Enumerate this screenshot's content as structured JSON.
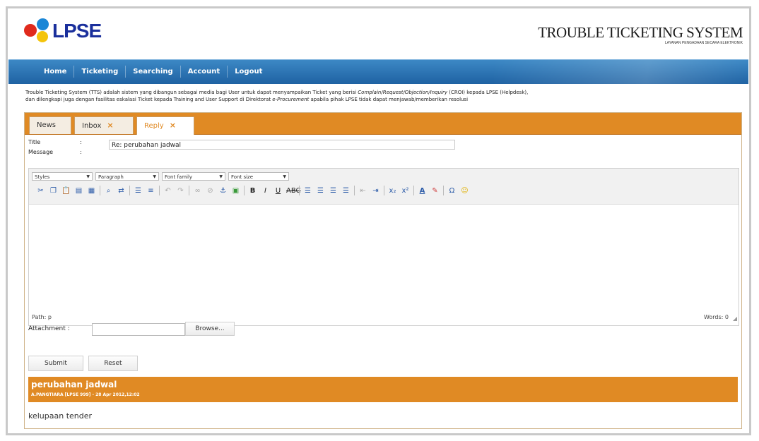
{
  "brand": {
    "logo_text": "LPSE",
    "system_title": "TROUBLE TICKETING SYSTEM",
    "system_subtitle": "LAYANAN PENGADAAN SECARA ELEKTRONIK"
  },
  "nav": {
    "items": [
      "Home",
      "Ticketing",
      "Searching",
      "Account",
      "Logout"
    ]
  },
  "description": {
    "part1": "Trouble Ticketing System (TTS) adalah sistem yang dibangun sebagai media bagi User untuk dapat menyampaikan Ticket yang berisi ",
    "italic1": "Complain/Request/Objection/Inquiry",
    "part2": " (CROI) kepada LPSE (Helpdesk),",
    "line2a": "dan dilengkapi juga dengan fasilitas eskalasi Ticket kepada Training and User Support di Direktorat ",
    "italic2": "e-Procurement",
    "line2b": " apabila pihak LPSE tidak dapat menjawab/memberikan resolusi"
  },
  "tabs": [
    {
      "label": "News",
      "closable": false
    },
    {
      "label": "Inbox",
      "closable": true
    },
    {
      "label": "Reply",
      "closable": true,
      "active": true
    }
  ],
  "tab_close_glyph": "×",
  "form": {
    "title_label": "Title",
    "message_label": "Message",
    "colon": ":",
    "title_value": "Re: perubahan jadwal",
    "attachment_label": "Attachment :",
    "browse_label": "Browse...",
    "submit_label": "Submit",
    "reset_label": "Reset"
  },
  "editor": {
    "dropdowns": [
      "Styles",
      "Paragraph",
      "Font family",
      "Font size"
    ],
    "path_label": "Path: p",
    "words_label": "Words: 0"
  },
  "reply": {
    "title": "perubahan jadwal",
    "meta": "A.PANGTIARA [LPSE 999] - 28 Apr 2012,12:02",
    "body": "kelupaan tender"
  },
  "colors": {
    "accent_orange": "#e08a24",
    "nav_blue": "#2a6fb0",
    "logo_blue": "#1a2f9c"
  }
}
